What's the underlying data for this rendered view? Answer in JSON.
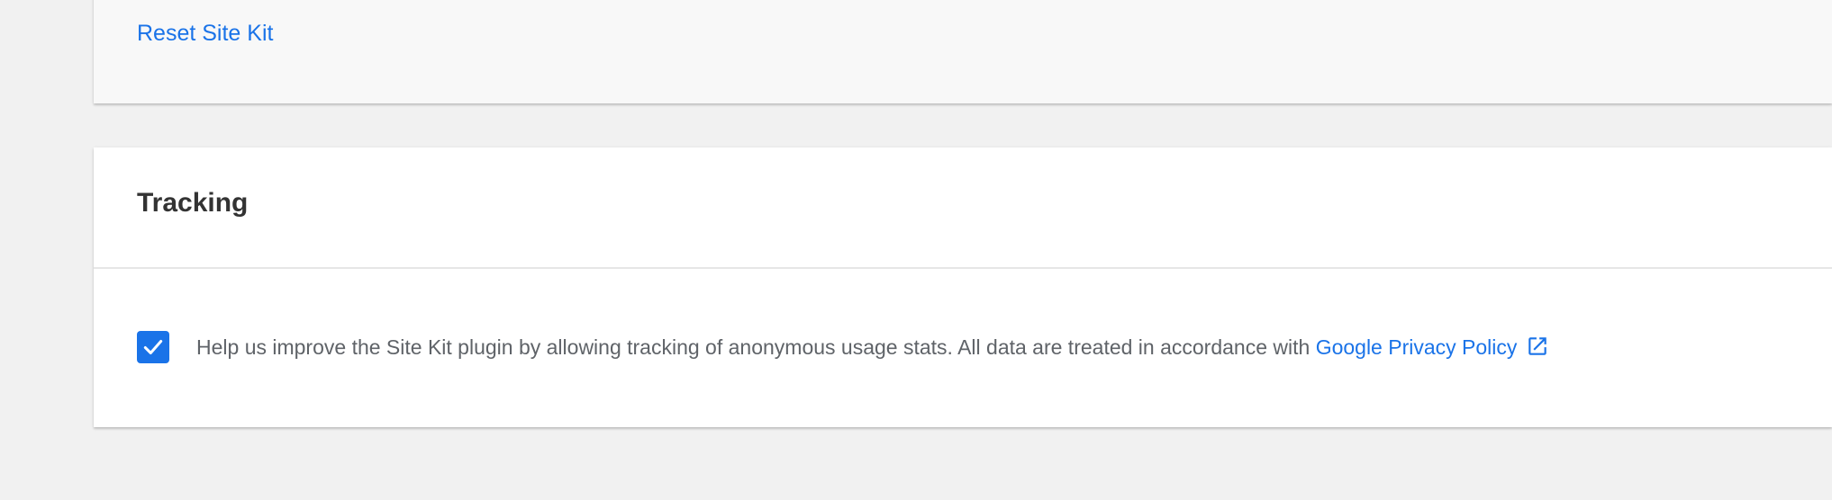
{
  "reset": {
    "label": "Reset Site Kit"
  },
  "tracking": {
    "title": "Tracking",
    "checkbox_checked": true,
    "description": "Help us improve the Site Kit plugin by allowing tracking of anonymous usage stats. All data are treated in accordance with ",
    "policy_link_label": "Google Privacy Policy",
    "policy_link_icon": "external-link-icon"
  },
  "colors": {
    "background": "#f1f1f1",
    "link": "#1a73e8",
    "checkbox": "#1a73e8",
    "title": "#333333",
    "body_text": "#5f6368"
  }
}
